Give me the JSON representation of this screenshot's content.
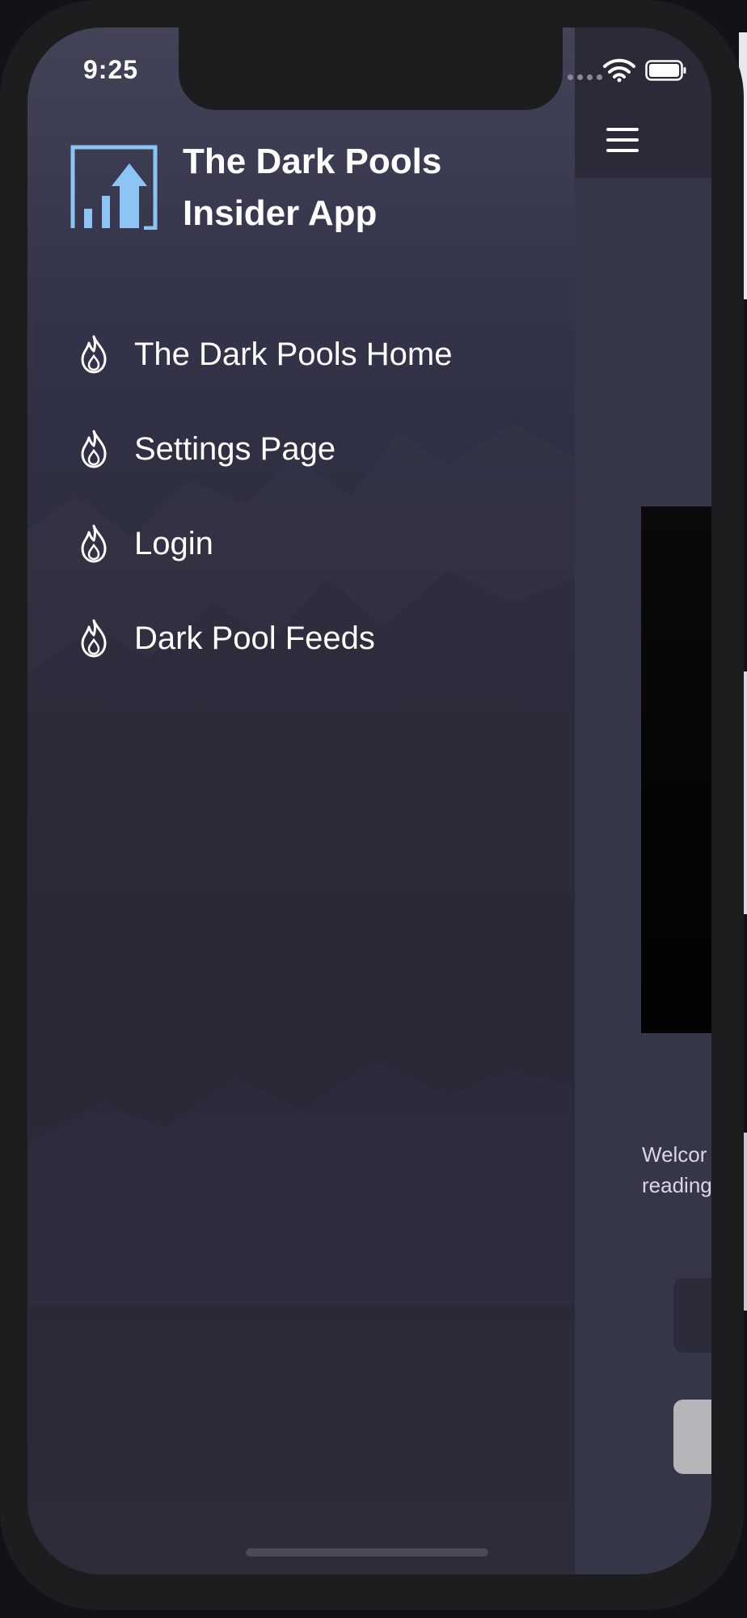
{
  "status_bar": {
    "time": "9:25",
    "icons": [
      "signal-dots-icon",
      "wifi-icon",
      "battery-icon"
    ]
  },
  "drawer": {
    "title_line1": "The Dark Pools",
    "title_line2": "Insider App",
    "logo_icon": "rising-bar-chart-logo",
    "menu_items": [
      {
        "label": "The Dark Pools Home",
        "icon": "flame-icon"
      },
      {
        "label": "Settings Page",
        "icon": "flame-icon"
      },
      {
        "label": "Login",
        "icon": "flame-icon"
      },
      {
        "label": "Dark Pool Feeds",
        "icon": "flame-icon"
      }
    ]
  },
  "app": {
    "menu_icon": "hamburger-menu-icon",
    "welcome_line1": "Welcor",
    "welcome_line2": "reading"
  },
  "colors": {
    "drawer_top": "#434358",
    "drawer_bottom": "#2c2c3b",
    "app_background": "#363649",
    "header_background": "#2a2a38",
    "logo_blue": "#8cc4f4",
    "text": "#ffffff"
  }
}
